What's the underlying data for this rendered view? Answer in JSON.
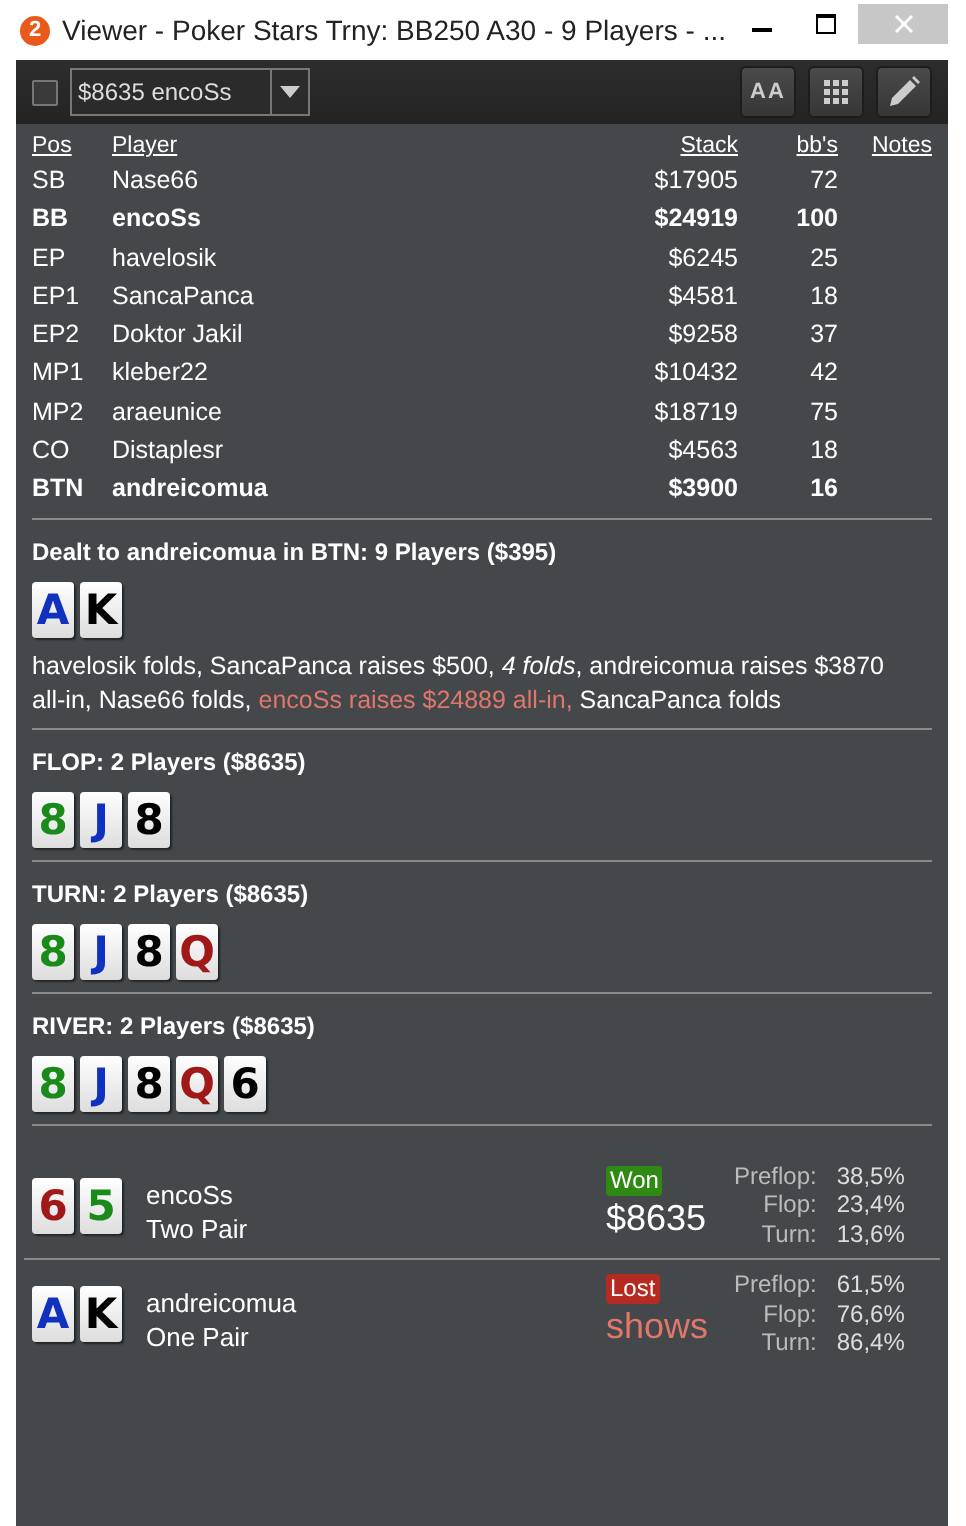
{
  "window": {
    "title": "Viewer - Poker Stars Trny: BB250 A30 - 9 Players - ...",
    "badge": "2"
  },
  "toolbar": {
    "checked": false,
    "dropdown_value": "$8635 encoSs",
    "font_button": "AA"
  },
  "table": {
    "columns": [
      "Pos",
      "Player",
      "Stack",
      "bb's",
      "Notes"
    ],
    "rows": [
      {
        "pos": "SB",
        "player": "Nase66",
        "stack": "$17905",
        "bbs": "72",
        "highlighted": false
      },
      {
        "pos": "BB",
        "player": "encoSs",
        "stack": "$24919",
        "bbs": "100",
        "highlighted": true
      },
      {
        "pos": "EP",
        "player": "havelosik",
        "stack": "$6245",
        "bbs": "25",
        "highlighted": false
      },
      {
        "pos": "EP1",
        "player": "SancaPanca",
        "stack": "$4581",
        "bbs": "18",
        "highlighted": false
      },
      {
        "pos": "EP2",
        "player": "Doktor Jakil",
        "stack": "$9258",
        "bbs": "37",
        "highlighted": false
      },
      {
        "pos": "MP1",
        "player": "kleber22",
        "stack": "$10432",
        "bbs": "42",
        "highlighted": false
      },
      {
        "pos": "MP2",
        "player": "araeunice",
        "stack": "$18719",
        "bbs": "75",
        "highlighted": false
      },
      {
        "pos": "CO",
        "player": "Distaplesr",
        "stack": "$4563",
        "bbs": "18",
        "highlighted": false
      },
      {
        "pos": "BTN",
        "player": "andreicomua",
        "stack": "$3900",
        "bbs": "16",
        "highlighted": true
      }
    ]
  },
  "streets": [
    {
      "title": "Dealt to andreicomua in BTN: 9 Players ($395)",
      "cards": [
        {
          "rank": "A",
          "color": "#1030c0"
        },
        {
          "rank": "K",
          "color": "#000000"
        }
      ],
      "actions": [
        {
          "text": "havelosik folds, SancaPanca raises $500, *4 folds*, andreicomua raises $3870 all-in, Nase66 folds, ",
          "kind": "normal"
        },
        {
          "text": "encoSs raises $24889 all-in, ",
          "kind": "aggressor"
        },
        {
          "text": "SancaPanca folds",
          "kind": "normal"
        }
      ]
    },
    {
      "title": "FLOP: 2 Players ($8635)",
      "cards": [
        {
          "rank": "8",
          "color": "#1a8a1a"
        },
        {
          "rank": "J",
          "color": "#1030c0"
        },
        {
          "rank": "8",
          "color": "#000000"
        }
      ]
    },
    {
      "title": "TURN: 2 Players ($8635)",
      "cards": [
        {
          "rank": "8",
          "color": "#1a8a1a"
        },
        {
          "rank": "J",
          "color": "#1030c0"
        },
        {
          "rank": "8",
          "color": "#000000"
        },
        {
          "rank": "Q",
          "color": "#a01818"
        }
      ]
    },
    {
      "title": "RIVER: 2 Players ($8635)",
      "cards": [
        {
          "rank": "8",
          "color": "#1a8a1a"
        },
        {
          "rank": "J",
          "color": "#1030c0"
        },
        {
          "rank": "8",
          "color": "#000000"
        },
        {
          "rank": "Q",
          "color": "#a01818"
        },
        {
          "rank": "6",
          "color": "#000000"
        }
      ]
    }
  ],
  "results": [
    {
      "cards": [
        {
          "rank": "6",
          "color": "#a01818"
        },
        {
          "rank": "5",
          "color": "#1a8a1a"
        }
      ],
      "player": "encoSs",
      "hand": "Two Pair",
      "outcome": "Won",
      "kind": "won",
      "amount": "$8635",
      "equity": [
        {
          "label": "Preflop:",
          "value": "38,5%"
        },
        {
          "label": "Flop:",
          "value": "23,4%"
        },
        {
          "label": "Turn:",
          "value": "13,6%"
        }
      ]
    },
    {
      "cards": [
        {
          "rank": "A",
          "color": "#1030c0"
        },
        {
          "rank": "K",
          "color": "#000000"
        }
      ],
      "player": "andreicomua",
      "hand": "One Pair",
      "outcome": "Lost",
      "kind": "lost",
      "amount": "shows",
      "equity": [
        {
          "label": "Preflop:",
          "value": "61,5%"
        },
        {
          "label": "Flop:",
          "value": "76,6%"
        },
        {
          "label": "Turn:",
          "value": "86,4%"
        }
      ]
    }
  ]
}
